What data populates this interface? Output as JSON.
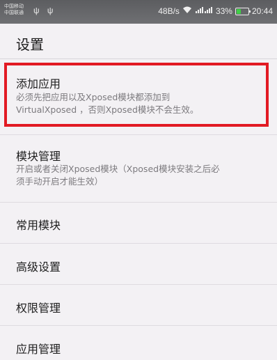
{
  "status_bar": {
    "carrier_line1": "中国移动",
    "carrier_line2": "中国联通",
    "usb_icons": "ψ ψ",
    "speed": "48B/s",
    "wifi_icon": "wifi-icon",
    "signal_icons": "ᵃᵢₗ ᵃᵢₗ",
    "battery_percent": "33%",
    "time": "20:44"
  },
  "header": {
    "title": "设置"
  },
  "items": [
    {
      "title": "添加应用",
      "subtitle_line1": "必须先把应用以及Xposed模块都添加到",
      "subtitle_line2": "VirtualXposed ，否则Xposed模块不会生效。"
    },
    {
      "title": "模块管理",
      "subtitle_line1": "开启或者关闭Xposed模块（Xposed模块安装之后必",
      "subtitle_line2": "须手动开启才能生效）"
    },
    {
      "title": "常用模块"
    },
    {
      "title": "高级设置"
    },
    {
      "title": "权限管理"
    },
    {
      "title": "应用管理"
    }
  ],
  "colors": {
    "highlight": "#e21a23",
    "battery_fill": "#3fcf47"
  }
}
